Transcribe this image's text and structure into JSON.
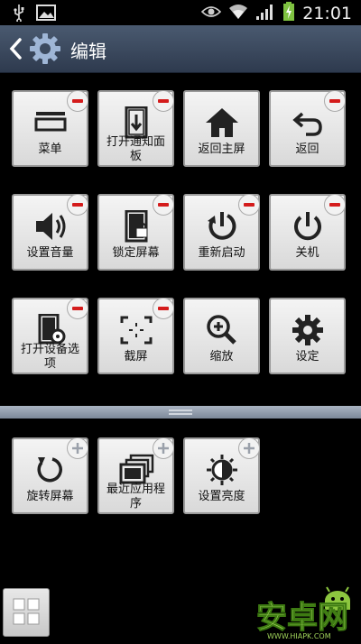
{
  "status_bar": {
    "time": "21:01"
  },
  "header": {
    "title": "编辑"
  },
  "active_tiles": [
    {
      "label": "菜单",
      "icon": "menu-icon"
    },
    {
      "label": "打开通知面板",
      "icon": "notification-panel-icon"
    },
    {
      "label": "返回主屏",
      "icon": "home-icon"
    },
    {
      "label": "返回",
      "icon": "back-arrow-icon"
    },
    {
      "label": "设置音量",
      "icon": "volume-icon"
    },
    {
      "label": "锁定屏幕",
      "icon": "lock-screen-icon"
    },
    {
      "label": "重新启动",
      "icon": "restart-icon"
    },
    {
      "label": "关机",
      "icon": "power-icon"
    },
    {
      "label": "打开设备选项",
      "icon": "device-options-icon"
    },
    {
      "label": "截屏",
      "icon": "screenshot-icon"
    },
    {
      "label": "缩放",
      "icon": "zoom-icon"
    },
    {
      "label": "设定",
      "icon": "settings-gear-icon"
    }
  ],
  "available_tiles": [
    {
      "label": "旋转屏幕",
      "icon": "rotate-icon"
    },
    {
      "label": "最近应用程序",
      "icon": "recent-apps-icon"
    },
    {
      "label": "设置亮度",
      "icon": "brightness-icon"
    }
  ],
  "watermark": {
    "text": "安卓网",
    "url_text": "WWW.HIAPK.COM"
  },
  "colors": {
    "remove_badge": "#d41c1c",
    "add_badge": "#9aa0aa",
    "title_bar": "#3c4a5e"
  }
}
